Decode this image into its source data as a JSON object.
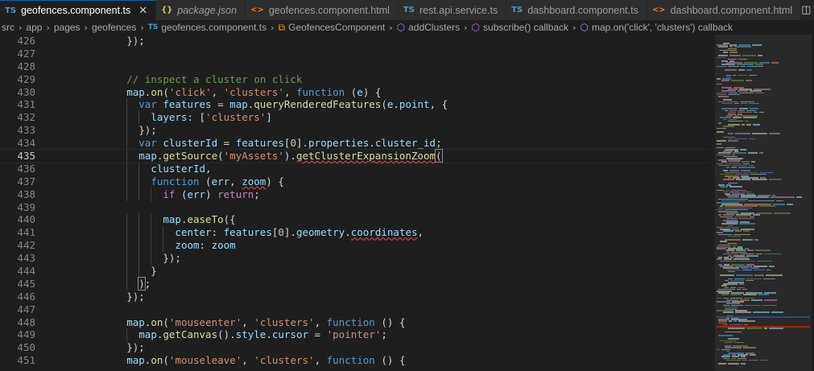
{
  "tabs": [
    {
      "icon": "TS",
      "icon_type": "ts",
      "label": "geofences.component.ts",
      "active": true,
      "italic": false,
      "close": "✕"
    },
    {
      "icon": "{}",
      "icon_type": "json",
      "label": "package.json",
      "active": false,
      "italic": true
    },
    {
      "icon": "<>",
      "icon_type": "html",
      "label": "geofences.component.html",
      "active": false,
      "italic": false
    },
    {
      "icon": "TS",
      "icon_type": "ts",
      "label": "rest.api.service.ts",
      "active": false,
      "italic": false
    },
    {
      "icon": "TS",
      "icon_type": "ts",
      "label": "dashboard.component.ts",
      "active": false,
      "italic": false
    },
    {
      "icon": "<>",
      "icon_type": "html",
      "label": "dashboard.component.html",
      "active": false,
      "italic": false
    }
  ],
  "tab_actions": {
    "split": "◫",
    "more": "···"
  },
  "breadcrumb": {
    "folders": [
      "src",
      "app",
      "pages",
      "geofences"
    ],
    "file_icon": "TS",
    "file": "geofences.component.ts",
    "class_icon": "⧉",
    "class": "GeofencesComponent",
    "method_icon": "⬡",
    "symbols": [
      "addClusters",
      "subscribe() callback",
      "map.on('click', 'clusters') callback"
    ],
    "separator": "›"
  },
  "editor": {
    "current_line": 435,
    "lines": [
      {
        "n": 426,
        "tokens": [
          [
            "pn",
            "        });"
          ]
        ]
      },
      {
        "n": 427,
        "tokens": []
      },
      {
        "n": 428,
        "tokens": []
      },
      {
        "n": 429,
        "tokens": [
          [
            "pn",
            "        "
          ],
          [
            "cmt",
            "// inspect a cluster on click"
          ]
        ]
      },
      {
        "n": 430,
        "tokens": [
          [
            "pn",
            "        "
          ],
          [
            "var",
            "map"
          ],
          [
            "pn",
            "."
          ],
          [
            "fn",
            "on"
          ],
          [
            "pn",
            "("
          ],
          [
            "str",
            "'click'"
          ],
          [
            "pn",
            ", "
          ],
          [
            "str",
            "'clusters'"
          ],
          [
            "pn",
            ", "
          ],
          [
            "kw",
            "function"
          ],
          [
            "pn",
            " ("
          ],
          [
            "var",
            "e"
          ],
          [
            "pn",
            ") {"
          ]
        ]
      },
      {
        "n": 431,
        "tokens": [
          [
            "pn",
            "          "
          ],
          [
            "kw",
            "var"
          ],
          [
            "pn",
            " "
          ],
          [
            "var",
            "features"
          ],
          [
            "pn",
            " = "
          ],
          [
            "var",
            "map"
          ],
          [
            "pn",
            "."
          ],
          [
            "fn",
            "queryRenderedFeatures"
          ],
          [
            "pn",
            "("
          ],
          [
            "var",
            "e"
          ],
          [
            "pn",
            "."
          ],
          [
            "var",
            "point"
          ],
          [
            "pn",
            ", {"
          ]
        ]
      },
      {
        "n": 432,
        "tokens": [
          [
            "pn",
            "            "
          ],
          [
            "var",
            "layers"
          ],
          [
            "pn",
            ": ["
          ],
          [
            "str",
            "'clusters'"
          ],
          [
            "pn",
            "]"
          ]
        ]
      },
      {
        "n": 433,
        "tokens": [
          [
            "pn",
            "          });"
          ]
        ]
      },
      {
        "n": 434,
        "tokens": [
          [
            "pn",
            "          "
          ],
          [
            "kw",
            "var"
          ],
          [
            "pn",
            " "
          ],
          [
            "var",
            "clusterId"
          ],
          [
            "pn",
            " = "
          ],
          [
            "var",
            "features"
          ],
          [
            "pn",
            "["
          ],
          [
            "num",
            "0"
          ],
          [
            "pn",
            "]."
          ],
          [
            "var",
            "properties"
          ],
          [
            "pn",
            "."
          ],
          [
            "var",
            "cluster_id"
          ],
          [
            "pn",
            ";"
          ]
        ]
      },
      {
        "n": 435,
        "tokens": [
          [
            "pn",
            "          "
          ],
          [
            "var",
            "map"
          ],
          [
            "pn",
            "."
          ],
          [
            "fn",
            "getSource"
          ],
          [
            "pn",
            "("
          ],
          [
            "str",
            "'myAssets'"
          ],
          [
            "pn",
            ")."
          ],
          [
            "fn squig",
            "getClusterExpansionZoom"
          ],
          [
            "pn bracket-hl",
            "("
          ]
        ]
      },
      {
        "n": 436,
        "tokens": [
          [
            "pn",
            "            "
          ],
          [
            "var",
            "clusterId"
          ],
          [
            "pn",
            ","
          ]
        ]
      },
      {
        "n": 437,
        "tokens": [
          [
            "pn",
            "            "
          ],
          [
            "kw",
            "function"
          ],
          [
            "pn",
            " ("
          ],
          [
            "var",
            "err"
          ],
          [
            "pn",
            ", "
          ],
          [
            "var squig",
            "zoom"
          ],
          [
            "pn",
            ") {"
          ]
        ]
      },
      {
        "n": 438,
        "tokens": [
          [
            "pn",
            "              "
          ],
          [
            "ctl",
            "if"
          ],
          [
            "pn",
            " ("
          ],
          [
            "var",
            "err"
          ],
          [
            "pn",
            ") "
          ],
          [
            "ctl",
            "return"
          ],
          [
            "pn",
            ";"
          ]
        ]
      },
      {
        "n": 439,
        "tokens": []
      },
      {
        "n": 440,
        "tokens": [
          [
            "pn",
            "              "
          ],
          [
            "var",
            "map"
          ],
          [
            "pn",
            "."
          ],
          [
            "fn",
            "easeTo"
          ],
          [
            "pn",
            "({"
          ]
        ]
      },
      {
        "n": 441,
        "tokens": [
          [
            "pn",
            "                "
          ],
          [
            "var",
            "center"
          ],
          [
            "pn",
            ": "
          ],
          [
            "var",
            "features"
          ],
          [
            "pn",
            "["
          ],
          [
            "num",
            "0"
          ],
          [
            "pn",
            "]."
          ],
          [
            "var",
            "geometry"
          ],
          [
            "pn",
            "."
          ],
          [
            "var squig",
            "coordinates"
          ],
          [
            "pn",
            ","
          ]
        ]
      },
      {
        "n": 442,
        "tokens": [
          [
            "pn",
            "                "
          ],
          [
            "var",
            "zoom"
          ],
          [
            "pn",
            ": "
          ],
          [
            "var",
            "zoom"
          ]
        ]
      },
      {
        "n": 443,
        "tokens": [
          [
            "pn",
            "              });"
          ]
        ]
      },
      {
        "n": 444,
        "tokens": [
          [
            "pn",
            "            }"
          ]
        ]
      },
      {
        "n": 445,
        "tokens": [
          [
            "pn",
            "          "
          ],
          [
            "pn bracket-hl",
            ")"
          ],
          [
            "pn",
            ";"
          ]
        ]
      },
      {
        "n": 446,
        "tokens": [
          [
            "pn",
            "        });"
          ]
        ]
      },
      {
        "n": 447,
        "tokens": []
      },
      {
        "n": 448,
        "tokens": [
          [
            "pn",
            "        "
          ],
          [
            "var",
            "map"
          ],
          [
            "pn",
            "."
          ],
          [
            "fn",
            "on"
          ],
          [
            "pn",
            "("
          ],
          [
            "str",
            "'mouseenter'"
          ],
          [
            "pn",
            ", "
          ],
          [
            "str",
            "'clusters'"
          ],
          [
            "pn",
            ", "
          ],
          [
            "kw",
            "function"
          ],
          [
            "pn",
            " () {"
          ]
        ]
      },
      {
        "n": 449,
        "tokens": [
          [
            "pn",
            "          "
          ],
          [
            "var",
            "map"
          ],
          [
            "pn",
            "."
          ],
          [
            "fn",
            "getCanvas"
          ],
          [
            "pn",
            "()."
          ],
          [
            "var",
            "style"
          ],
          [
            "pn",
            "."
          ],
          [
            "var",
            "cursor"
          ],
          [
            "pn",
            " = "
          ],
          [
            "str",
            "'pointer'"
          ],
          [
            "pn",
            ";"
          ]
        ]
      },
      {
        "n": 450,
        "tokens": [
          [
            "pn",
            "        });"
          ]
        ]
      },
      {
        "n": 451,
        "tokens": [
          [
            "pn",
            "        "
          ],
          [
            "var",
            "map"
          ],
          [
            "pn",
            "."
          ],
          [
            "fn",
            "on"
          ],
          [
            "pn",
            "("
          ],
          [
            "str",
            "'mouseleave'"
          ],
          [
            "pn",
            ", "
          ],
          [
            "str",
            "'clusters'"
          ],
          [
            "pn",
            ", "
          ],
          [
            "kw",
            "function"
          ],
          [
            "pn",
            " () {"
          ]
        ]
      }
    ]
  },
  "colors": {
    "background": "#1e1e1e",
    "tab_active_border": "#0e639c",
    "keyword": "#569cd6",
    "string": "#ce9178",
    "function": "#dcdcaa",
    "variable": "#9cdcfe",
    "comment": "#6a9955",
    "error_squiggle": "#f14c4c"
  }
}
